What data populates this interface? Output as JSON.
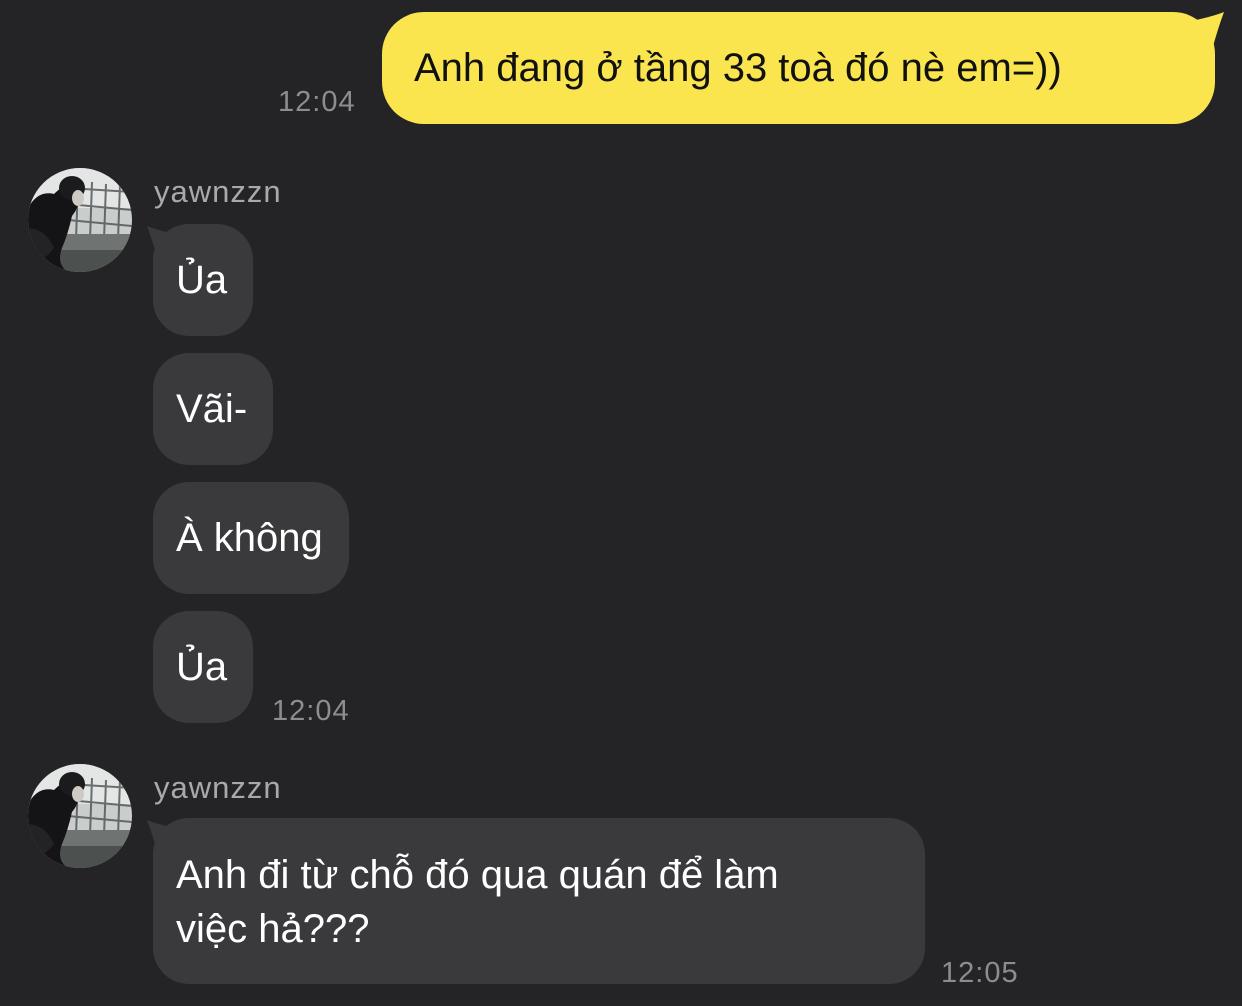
{
  "chat": {
    "outgoing": {
      "text": "Anh đang ở tầng 33 toà đó nè em=))",
      "time": "12:04"
    },
    "group1": {
      "sender": "yawnzzn",
      "messages": [
        "Ủa",
        "Vãi-",
        "À không",
        "Ủa"
      ],
      "time": "12:04"
    },
    "group2": {
      "sender": "yawnzzn",
      "message_line1": "Anh đi từ chỗ đó qua quán để làm",
      "message_line2": "việc hả???",
      "time": "12:05"
    }
  },
  "colors": {
    "background": "#242427",
    "outgoing_bubble": "#fae54f",
    "incoming_bubble": "#3a3a3d",
    "timestamp": "#8d8d91",
    "sender_name": "#a9a9ad"
  }
}
